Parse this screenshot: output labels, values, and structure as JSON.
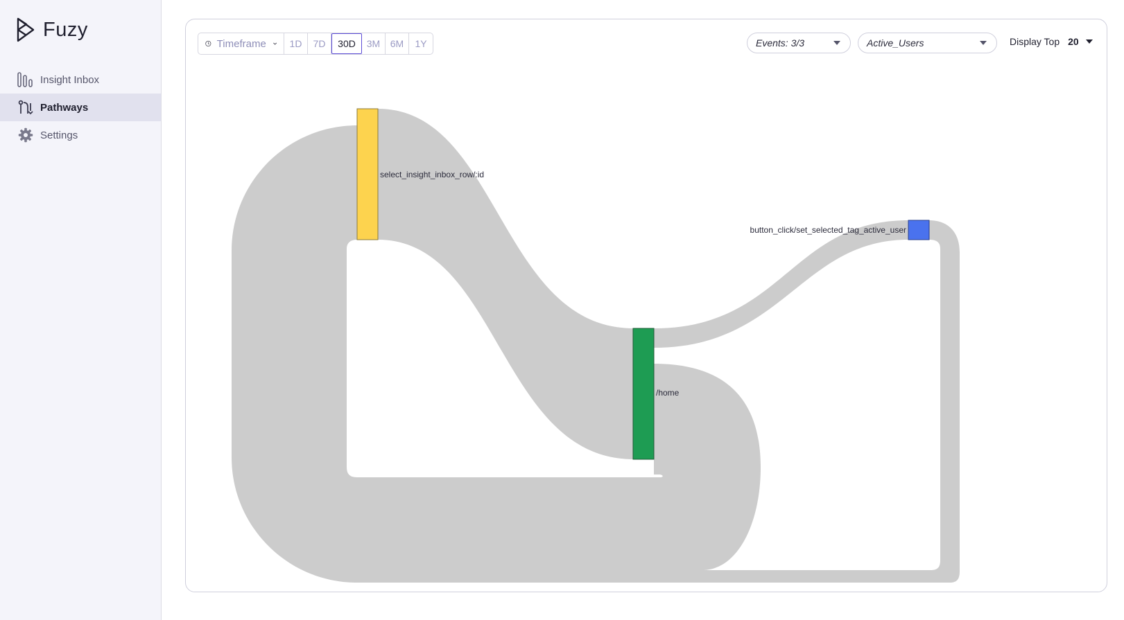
{
  "app": {
    "name": "Fuzy"
  },
  "sidebar": {
    "items": [
      {
        "label": "Insight Inbox",
        "icon": "bar-chart-icon",
        "active": false
      },
      {
        "label": "Pathways",
        "icon": "pathways-icon",
        "active": true
      },
      {
        "label": "Settings",
        "icon": "gear-icon",
        "active": false
      }
    ]
  },
  "toolbar": {
    "timeframe_label": "Timeframe",
    "ranges": [
      "1D",
      "7D",
      "30D",
      "3M",
      "6M",
      "1Y"
    ],
    "selected_range": "30D",
    "events_filter": "Events: 3/3",
    "cohort_filter": "Active_Users",
    "display_top_label": "Display Top",
    "display_top_value": "20"
  },
  "sankey": {
    "nodes": [
      {
        "label": "select_insight_inbox_row/:id",
        "color": "#fdd34e"
      },
      {
        "label": "/home",
        "color": "#1e9c53"
      },
      {
        "label": "button_click/set_selected_tag_active_user",
        "color": "#4a72ee"
      }
    ],
    "link_color": "#cccccc"
  }
}
